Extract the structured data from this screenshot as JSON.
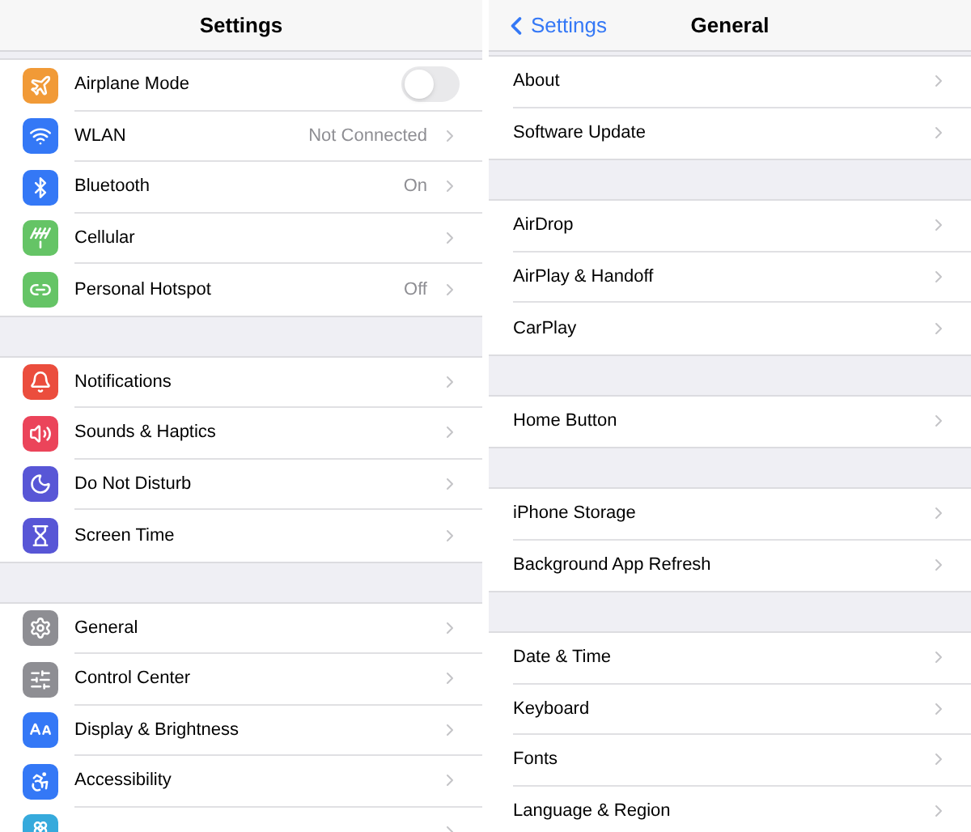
{
  "panels": [
    {
      "title": "Settings",
      "groups": [
        [
          {
            "label": "Airplane Mode",
            "color": "#f19a37",
            "kind": "toggle",
            "on": false
          },
          {
            "label": "WLAN",
            "color": "#3478f6",
            "kind": "link",
            "value": "Not Connected"
          },
          {
            "label": "Bluetooth",
            "color": "#3478f6",
            "kind": "link",
            "value": "On"
          },
          {
            "label": "Cellular",
            "color": "#65c466",
            "kind": "link"
          },
          {
            "label": "Personal Hotspot",
            "color": "#65c466",
            "kind": "link",
            "value": "Off"
          }
        ],
        [
          {
            "label": "Notifications",
            "color": "#eb4d3d",
            "kind": "link"
          },
          {
            "label": "Sounds & Haptics",
            "color": "#eb445a",
            "kind": "link"
          },
          {
            "label": "Do Not Disturb",
            "color": "#5856d6",
            "kind": "link"
          },
          {
            "label": "Screen Time",
            "color": "#5856d6",
            "kind": "link"
          }
        ],
        [
          {
            "label": "General",
            "color": "#8e8e93",
            "kind": "link"
          },
          {
            "label": "Control Center",
            "color": "#8e8e93",
            "kind": "link"
          },
          {
            "label": "Display & Brightness",
            "color": "#3478f6",
            "kind": "link"
          },
          {
            "label": "Accessibility",
            "color": "#3478f6",
            "kind": "link"
          },
          {
            "color": "#36aadc",
            "kind": "link"
          }
        ]
      ]
    },
    {
      "back": "Settings",
      "title": "General",
      "groups": [
        [
          {
            "label": "About",
            "kind": "link"
          },
          {
            "label": "Software Update",
            "kind": "link"
          }
        ],
        [
          {
            "label": "AirDrop",
            "kind": "link"
          },
          {
            "label": "AirPlay & Handoff",
            "kind": "link"
          },
          {
            "label": "CarPlay",
            "kind": "link"
          }
        ],
        [
          {
            "label": "Home Button",
            "kind": "link"
          }
        ],
        [
          {
            "label": "iPhone Storage",
            "kind": "link"
          },
          {
            "label": "Background App Refresh",
            "kind": "link"
          }
        ],
        [
          {
            "label": "Date & Time",
            "kind": "link"
          },
          {
            "label": "Keyboard",
            "kind": "link"
          },
          {
            "label": "Fonts",
            "kind": "link"
          },
          {
            "label": "Language & Region",
            "kind": "link"
          }
        ]
      ]
    }
  ]
}
